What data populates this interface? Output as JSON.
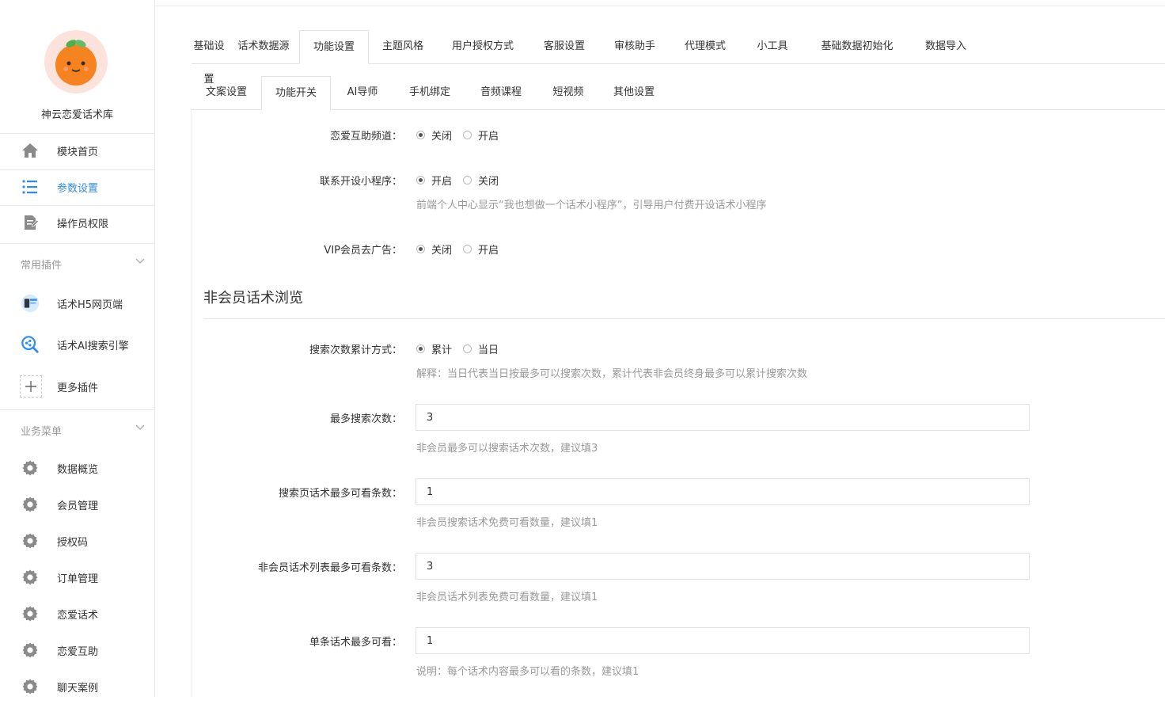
{
  "app": {
    "name": "神云恋爱话术库"
  },
  "sidebar": {
    "top_items": [
      {
        "label": "模块首页",
        "icon": "home-icon"
      },
      {
        "label": "参数设置",
        "icon": "list-icon",
        "active": true
      },
      {
        "label": "操作员权限",
        "icon": "document-edit-icon"
      }
    ],
    "plugins_title": "常用插件",
    "plugins": [
      {
        "label": "话术H5网页端",
        "icon": "h5-plugin-icon"
      },
      {
        "label": "话术AI搜索引擎",
        "icon": "ai-search-icon"
      },
      {
        "label": "更多插件",
        "icon": "plus-icon"
      }
    ],
    "business_title": "业务菜单",
    "business": [
      {
        "label": "数据概览",
        "icon": "gear-icon"
      },
      {
        "label": "会员管理",
        "icon": "gear-icon"
      },
      {
        "label": "授权码",
        "icon": "gear-icon"
      },
      {
        "label": "订单管理",
        "icon": "gear-icon"
      },
      {
        "label": "恋爱话术",
        "icon": "gear-icon"
      },
      {
        "label": "恋爱互助",
        "icon": "gear-icon"
      },
      {
        "label": "聊天案例",
        "icon": "gear-icon"
      }
    ]
  },
  "tabs_primary": [
    "基础设置",
    "话术数据源",
    "功能设置",
    "主题风格",
    "用户授权方式",
    "客服设置",
    "审核助手",
    "代理模式",
    "小工具",
    "基础数据初始化",
    "数据导入"
  ],
  "tabs_primary_active": "功能设置",
  "tabs_secondary": [
    "文案设置",
    "功能开关",
    "AI导师",
    "手机绑定",
    "音频课程",
    "短视频",
    "其他设置"
  ],
  "tabs_secondary_active": "功能开关",
  "form": {
    "love_help": {
      "label": "恋爱互助频道：",
      "options": [
        "关闭",
        "开启"
      ],
      "selected": "关闭"
    },
    "contact_open": {
      "label": "联系开设小程序：",
      "options": [
        "开启",
        "关闭"
      ],
      "selected": "开启",
      "help": "前端个人中心显示“我也想做一个话术小程序”，引导用户付费开设话术小程序"
    },
    "vip_no_ads": {
      "label": "VIP会员去广告：",
      "options": [
        "关闭",
        "开启"
      ],
      "selected": "关闭"
    },
    "section_title": "非会员话术浏览",
    "search_count_mode": {
      "label": "搜索次数累计方式：",
      "options": [
        "累计",
        "当日"
      ],
      "selected": "累计",
      "help": "解释：当日代表当日按最多可以搜索次数，累计代表非会员终身最多可以累计搜索次数"
    },
    "max_search": {
      "label": "最多搜索次数：",
      "value": "3",
      "help": "非会员最多可以搜索话术次数，建议填3"
    },
    "search_page_max": {
      "label": "搜索页话术最多可看条数：",
      "value": "1",
      "help": "非会员搜索话术免费可看数量，建议填1"
    },
    "list_max": {
      "label": "非会员话术列表最多可看条数：",
      "value": "3",
      "help": "非会员话术列表免费可看数量，建议填1"
    },
    "single_max": {
      "label": "单条话术最多可看：",
      "value": "1",
      "help": "说明：每个话术内容最多可以看的条数，建议填1"
    }
  },
  "colors": {
    "accent": "#2d8cf0",
    "icon_gray": "#8a8a8a",
    "logo_orange": "#f5831f"
  }
}
